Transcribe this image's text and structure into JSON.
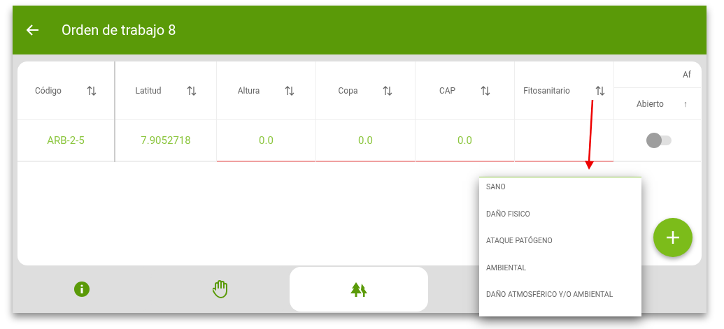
{
  "header": {
    "title": "Orden de trabajo 8"
  },
  "table": {
    "columns": [
      {
        "label": "Código"
      },
      {
        "label": "Latitud"
      },
      {
        "label": "Altura"
      },
      {
        "label": "Copa"
      },
      {
        "label": "CAP"
      },
      {
        "label": "Fitosanitario"
      }
    ],
    "group_column": {
      "label": "Af",
      "sub_label": "Abierto",
      "sub_icon": "↑"
    },
    "row": {
      "cells": [
        {
          "text": "ARB-2-5",
          "error": false
        },
        {
          "text": "7.9052718",
          "error": false
        },
        {
          "text": "0.0",
          "error": true
        },
        {
          "text": "0.0",
          "error": true
        },
        {
          "text": "0.0",
          "error": true
        },
        {
          "text": "",
          "error": true
        }
      ],
      "toggle_on": false
    }
  },
  "dropdown": {
    "options": [
      "SANO",
      "DAÑO FISICO",
      "ATAQUE PATÓGENO",
      "AMBIENTAL",
      "DAÑO ATMOSFÉRICO Y/O AMBIENTAL"
    ]
  },
  "bottom_tabs": [
    {
      "kind": "info",
      "selected": false
    },
    {
      "kind": "hand",
      "selected": false
    },
    {
      "kind": "trees",
      "selected": true
    }
  ]
}
